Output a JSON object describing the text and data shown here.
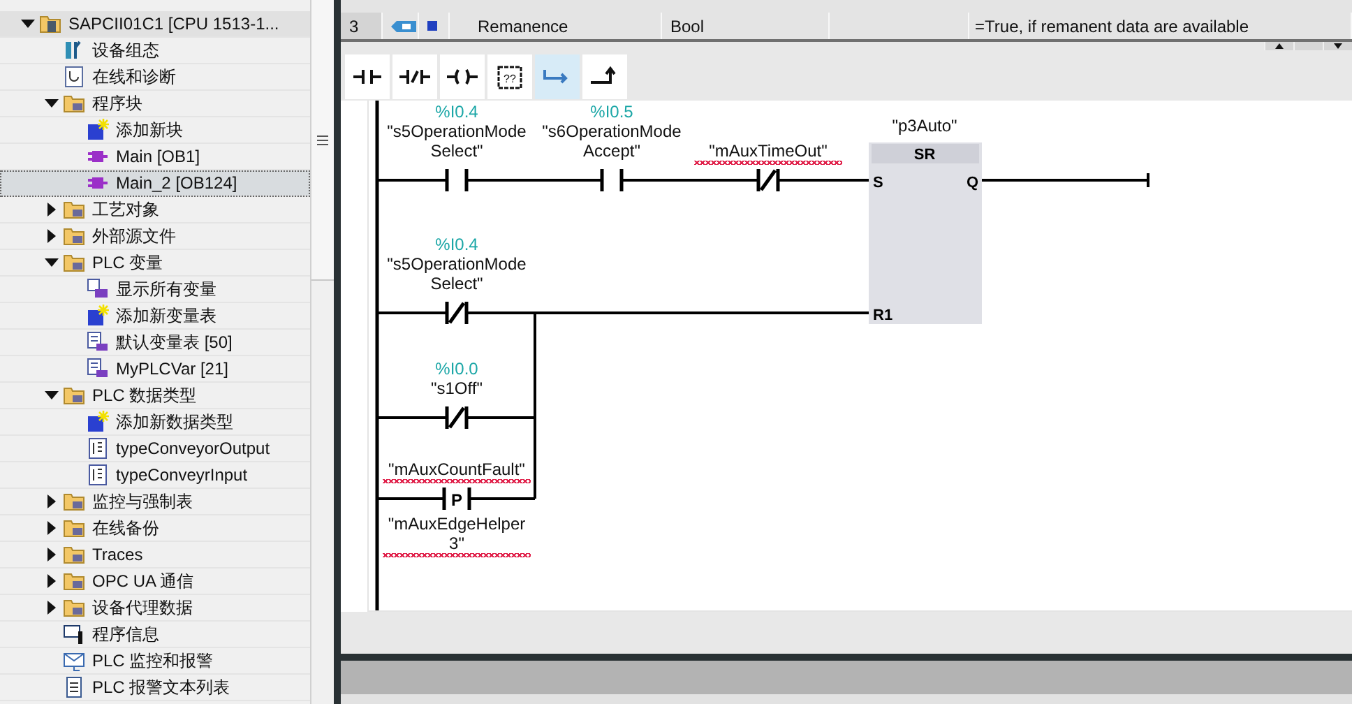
{
  "tree": [
    {
      "label": "SAPCII01C1 [CPU 1513-1...",
      "kind": "device",
      "expanded": true,
      "selected": false,
      "highlighted": true,
      "children": [
        {
          "label": "设备组态",
          "kind": "config",
          "selected": false,
          "highlighted": false
        },
        {
          "label": "在线和诊断",
          "kind": "diag",
          "selected": false,
          "highlighted": false
        },
        {
          "label": "程序块",
          "kind": "folder",
          "expanded": true,
          "selected": false,
          "highlighted": false,
          "children": [
            {
              "label": "添加新块",
              "kind": "add",
              "selected": false,
              "highlighted": false
            },
            {
              "label": "Main [OB1]",
              "kind": "block",
              "selected": false,
              "highlighted": false
            },
            {
              "label": "Main_2 [OB124]",
              "kind": "block",
              "selected": true,
              "highlighted": false
            }
          ]
        },
        {
          "label": "工艺对象",
          "kind": "folder",
          "expanded": false,
          "selected": false,
          "highlighted": false
        },
        {
          "label": "外部源文件",
          "kind": "folder",
          "expanded": false,
          "selected": false,
          "highlighted": false
        },
        {
          "label": "PLC 变量",
          "kind": "folder",
          "expanded": true,
          "selected": false,
          "highlighted": false,
          "children": [
            {
              "label": "显示所有变量",
              "kind": "tags",
              "selected": false,
              "highlighted": false
            },
            {
              "label": "添加新变量表",
              "kind": "add",
              "selected": false,
              "highlighted": false
            },
            {
              "label": "默认变量表 [50]",
              "kind": "tagtable",
              "selected": false,
              "highlighted": false
            },
            {
              "label": "MyPLCVar [21]",
              "kind": "tagtable",
              "selected": false,
              "highlighted": false
            }
          ]
        },
        {
          "label": "PLC 数据类型",
          "kind": "folder",
          "expanded": true,
          "selected": false,
          "highlighted": false,
          "children": [
            {
              "label": "添加新数据类型",
              "kind": "add",
              "selected": false,
              "highlighted": false
            },
            {
              "label": "typeConveyorOutput",
              "kind": "datatype",
              "selected": false,
              "highlighted": false
            },
            {
              "label": "typeConveyrInput",
              "kind": "datatype",
              "selected": false,
              "highlighted": false
            }
          ]
        },
        {
          "label": "监控与强制表",
          "kind": "folder",
          "expanded": false,
          "selected": false,
          "highlighted": false
        },
        {
          "label": "在线备份",
          "kind": "folder",
          "expanded": false,
          "selected": false,
          "highlighted": false
        },
        {
          "label": "Traces",
          "kind": "folder",
          "expanded": false,
          "selected": false,
          "highlighted": false
        },
        {
          "label": "OPC UA 通信",
          "kind": "folder",
          "expanded": false,
          "selected": false,
          "highlighted": false
        },
        {
          "label": "设备代理数据",
          "kind": "folder",
          "expanded": false,
          "selected": false,
          "highlighted": false
        },
        {
          "label": "程序信息",
          "kind": "info",
          "selected": false,
          "highlighted": false
        },
        {
          "label": "PLC 监控和报警",
          "kind": "alarm",
          "selected": false,
          "highlighted": false
        },
        {
          "label": "PLC 报警文本列表",
          "kind": "textlist",
          "selected": false,
          "highlighted": false
        }
      ]
    }
  ],
  "interface_table": {
    "rows": [
      {
        "number": "3",
        "name": "Remanence",
        "type": "Bool",
        "comment": "=True, if remanent data are available"
      }
    ]
  },
  "toolbar": [
    {
      "kind": "no-contact",
      "selected": false
    },
    {
      "kind": "nc-contact",
      "selected": false
    },
    {
      "kind": "coil",
      "selected": false
    },
    {
      "kind": "empty-box",
      "symbol": "??",
      "selected": false
    },
    {
      "kind": "open-branch",
      "selected": true
    },
    {
      "kind": "close-branch",
      "selected": false
    }
  ],
  "network": {
    "elements": [
      {
        "kind": "no-contact",
        "address": "%I0.4",
        "tag": "\"s5OperationModeSelect\"",
        "undefined": false
      },
      {
        "kind": "no-contact",
        "address": "%I0.5",
        "tag": "\"s6OperationModeAccept\"",
        "undefined": false
      },
      {
        "kind": "nc-contact",
        "tag": "\"mAuxTimeOut\"",
        "undefined": true
      },
      {
        "kind": "sr-box",
        "tag": "\"p3Auto\"",
        "title": "SR",
        "inputs": [
          "S",
          "R1"
        ],
        "output": "Q",
        "undefined": false
      },
      {
        "kind": "nc-contact",
        "address": "%I0.4",
        "tag": "\"s5OperationModeSelect\"",
        "undefined": false
      },
      {
        "kind": "nc-contact",
        "address": "%I0.0",
        "tag": "\"s1Off\"",
        "undefined": false
      },
      {
        "kind": "p-contact",
        "symbol": "P",
        "tag": "\"mAuxCountFault\"",
        "helper": "\"mAuxEdgeHelper3\"",
        "undefined": true
      }
    ]
  }
}
